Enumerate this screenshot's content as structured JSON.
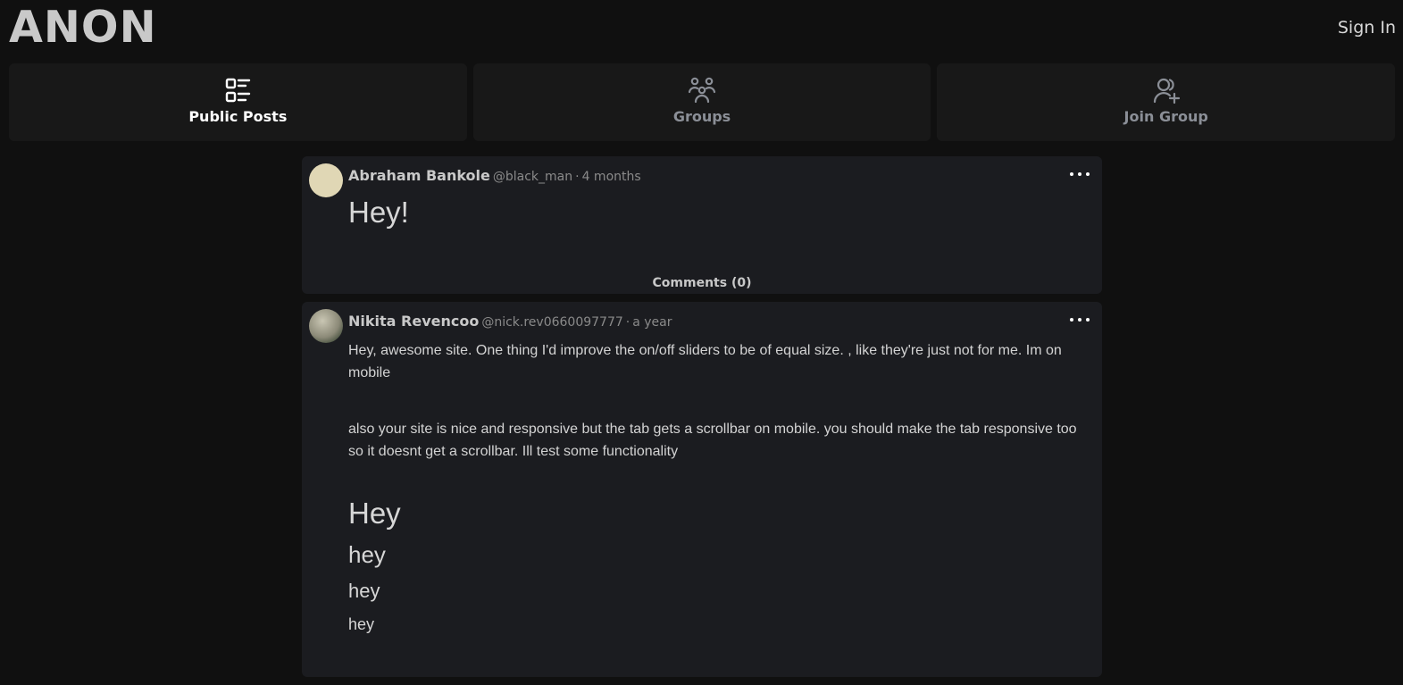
{
  "header": {
    "logo": "ANON",
    "sign_in": "Sign In"
  },
  "tabs": [
    {
      "label": "Public Posts",
      "icon": "list-icon",
      "active": true
    },
    {
      "label": "Groups",
      "icon": "groups-icon",
      "active": false
    },
    {
      "label": "Join Group",
      "icon": "user-plus-icon",
      "active": false
    }
  ],
  "posts": [
    {
      "author": "Abraham Bankole",
      "handle": "@black_man",
      "separator": "·",
      "time": "4 months",
      "heading": "Hey!",
      "comments": "Comments (0)"
    },
    {
      "author": "Nikita Revencoo",
      "handle": "@nick.rev0660097777",
      "separator": "·",
      "time": "a year",
      "paragraphs": [
        "Hey, awesome site. One thing I'd improve the on/off sliders to be of equal size. , like they're just not for me. Im on mobile",
        "also your site is nice and responsive but the tab gets a scrollbar on mobile. you should make the tab responsive too so it doesnt get a scrollbar. Ill test some functionality"
      ],
      "headings": [
        "Hey",
        "hey",
        "hey",
        "hey"
      ]
    }
  ],
  "colors": {
    "background": "#101010",
    "card": "#1b1c20",
    "tab": "#181818",
    "muted": "#8b8f97"
  }
}
